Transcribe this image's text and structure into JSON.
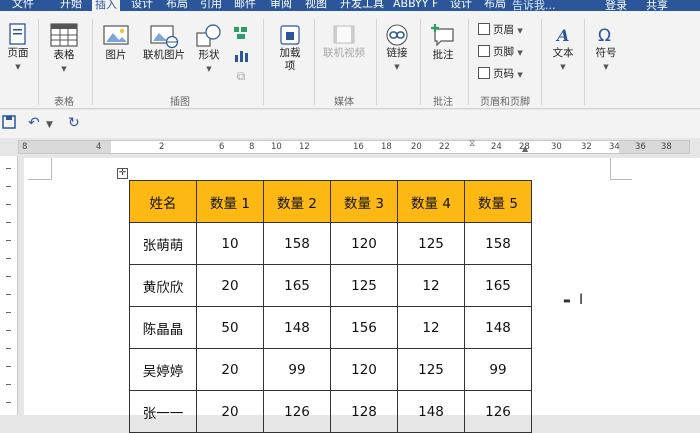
{
  "tabs": [
    "文件",
    "开始",
    "插入",
    "设计",
    "布局",
    "引用",
    "邮件",
    "审阅",
    "视图",
    "开发工具",
    "ABBYY F",
    "设计",
    "布局"
  ],
  "active_tab_index": 2,
  "tell_me": "告诉我...",
  "login": "登录",
  "share": "共享",
  "ribbon": {
    "page": "页面",
    "table": "表格",
    "table_group": "表格",
    "picture": "图片",
    "online_picture": "联机图片",
    "shapes": "形状",
    "illustrations_group": "插图",
    "addins": "加载",
    "addins2": "项",
    "online_video": "联机视频",
    "media_group": "媒体",
    "link": "链接",
    "comment": "批注",
    "comment_group": "批注",
    "header": "页眉",
    "footer": "页脚",
    "page_number": "页码",
    "header_footer_group": "页眉和页脚",
    "text": "文本",
    "symbol": "符号"
  },
  "ruler_numbers": [
    "8",
    "4",
    "2",
    "6",
    "8",
    "10",
    "12",
    "16",
    "18",
    "20",
    "22",
    "24",
    "28",
    "30",
    "32",
    "34",
    "36",
    "38"
  ],
  "table": {
    "headers": [
      "姓名",
      "数量 1",
      "数量 2",
      "数量 3",
      "数量 4",
      "数量 5"
    ],
    "rows": [
      [
        "张萌萌",
        "10",
        "158",
        "120",
        "125",
        "158"
      ],
      [
        "黄欣欣",
        "20",
        "165",
        "125",
        "12",
        "165"
      ],
      [
        "陈晶晶",
        "50",
        "148",
        "156",
        "12",
        "148"
      ],
      [
        "吴婷婷",
        "20",
        "99",
        "120",
        "125",
        "99"
      ],
      [
        "张一一",
        "20",
        "126",
        "128",
        "148",
        "126"
      ]
    ],
    "header_color": "#fdb813"
  },
  "accent_color": "#2b579a"
}
